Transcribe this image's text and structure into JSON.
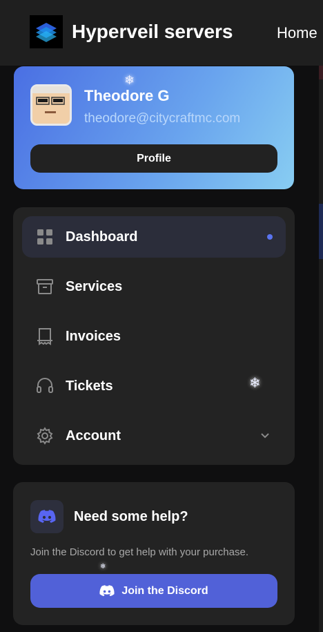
{
  "header": {
    "brand_name": "Hyperveil servers",
    "nav_home": "Home"
  },
  "profile": {
    "name": "Theodore G",
    "email": "theodore@citycraftmc.com",
    "button_label": "Profile"
  },
  "sidebar": {
    "items": [
      {
        "label": "Dashboard",
        "icon": "grid-icon",
        "active": true
      },
      {
        "label": "Services",
        "icon": "archive-icon",
        "active": false
      },
      {
        "label": "Invoices",
        "icon": "receipt-icon",
        "active": false
      },
      {
        "label": "Tickets",
        "icon": "headset-icon",
        "active": false
      },
      {
        "label": "Account",
        "icon": "gear-icon",
        "active": false,
        "expandable": true
      }
    ]
  },
  "help": {
    "title": "Need some help?",
    "text": "Join the Discord to get help with your purchase.",
    "button_label": "Join the Discord",
    "icon": "discord-icon"
  },
  "colors": {
    "accent": "#5161d8",
    "background": "#0f0f10",
    "card": "#232323",
    "profile_gradient_start": "#4a6fe3",
    "profile_gradient_end": "#88cdf2"
  }
}
